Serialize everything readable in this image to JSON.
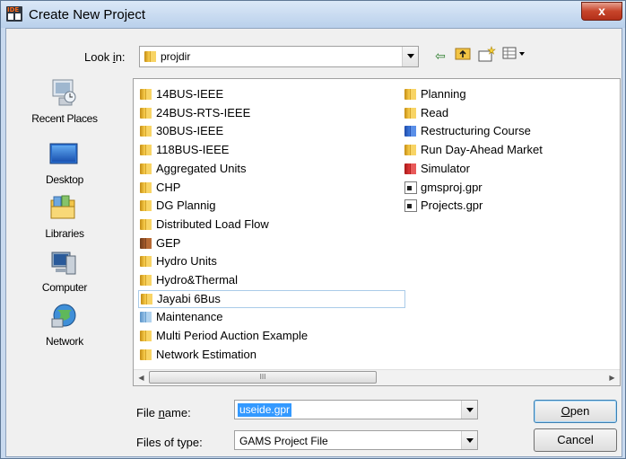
{
  "window": {
    "title": "Create New Project",
    "app_icon_text": "IDE",
    "close_symbol": "x"
  },
  "lookin": {
    "label_pre": "Look ",
    "label_key": "i",
    "label_post": "n:",
    "value": "projdir"
  },
  "toolbar": {
    "back_glyph": "⇦",
    "up_glyph": "⬆",
    "newfolder_glyph": "☆",
    "view_glyph": "▦▾"
  },
  "places": [
    {
      "label": "Recent Places",
      "icon": "recent-places-icon"
    },
    {
      "label": "Desktop",
      "icon": "desktop-icon"
    },
    {
      "label": "Libraries",
      "icon": "libraries-icon"
    },
    {
      "label": "Computer",
      "icon": "computer-icon"
    },
    {
      "label": "Network",
      "icon": "network-icon"
    }
  ],
  "files": {
    "col1": [
      {
        "name": "14BUS-IEEE",
        "type": "folder"
      },
      {
        "name": "24BUS-RTS-IEEE",
        "type": "folder"
      },
      {
        "name": "30BUS-IEEE",
        "type": "folder"
      },
      {
        "name": "118BUS-IEEE",
        "type": "folder"
      },
      {
        "name": "Aggregated Units",
        "type": "folder"
      },
      {
        "name": "CHP",
        "type": "folder"
      },
      {
        "name": "DG Plannig",
        "type": "folder"
      },
      {
        "name": "Distributed Load Flow",
        "type": "folder"
      },
      {
        "name": "GEP",
        "type": "folder-brown"
      },
      {
        "name": "Hydro Units",
        "type": "folder"
      },
      {
        "name": "Hydro&Thermal",
        "type": "folder"
      },
      {
        "name": "Jayabi 6Bus",
        "type": "folder",
        "selected": true
      },
      {
        "name": "Maintenance",
        "type": "folder-lightblue"
      },
      {
        "name": "Multi Period Auction Example",
        "type": "folder"
      },
      {
        "name": "Network Estimation",
        "type": "folder"
      }
    ],
    "col2": [
      {
        "name": "Planning",
        "type": "folder"
      },
      {
        "name": "Read",
        "type": "folder"
      },
      {
        "name": "Restructuring Course",
        "type": "folder-blue"
      },
      {
        "name": "Run Day-Ahead Market",
        "type": "folder"
      },
      {
        "name": "Simulator",
        "type": "folder-red"
      },
      {
        "name": "gmsproj.gpr",
        "type": "file"
      },
      {
        "name": "Projects.gpr",
        "type": "file"
      }
    ]
  },
  "scrollbar": {
    "left_arrow": "◀",
    "right_arrow": "▶",
    "grip": "III"
  },
  "filename": {
    "label_pre": "File ",
    "label_key": "n",
    "label_post": "ame:",
    "value": "useide.gpr"
  },
  "filetype": {
    "label": "Files of type:",
    "value": "GAMS Project File"
  },
  "buttons": {
    "open_key": "O",
    "open_rest": "pen",
    "cancel": "Cancel"
  }
}
